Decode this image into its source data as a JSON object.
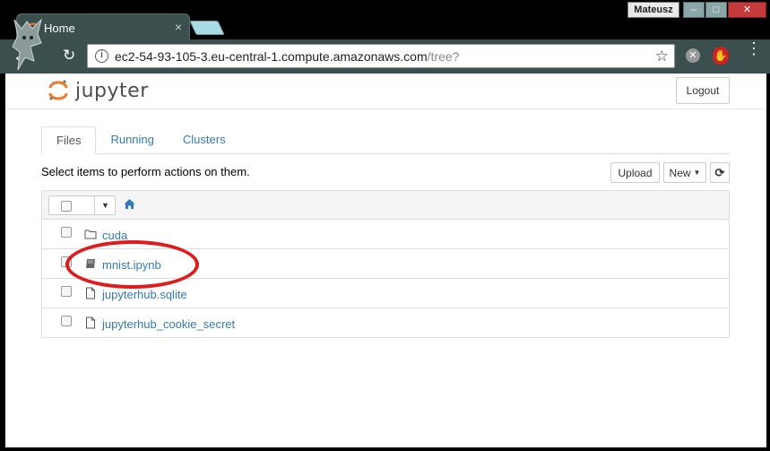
{
  "browser": {
    "tab_title": "Home",
    "tab_close": "×",
    "profile_name": "Mateusz",
    "window_buttons": [
      "–",
      "□",
      "✕"
    ],
    "url_host": "ec2-54-93-105-3.eu-central-1.compute.amazonaws.com",
    "url_path": "/tree?"
  },
  "jupyter": {
    "logo_text": "jupyter",
    "logout_label": "Logout",
    "tabs": [
      {
        "label": "Files",
        "active": true
      },
      {
        "label": "Running",
        "active": false
      },
      {
        "label": "Clusters",
        "active": false
      }
    ],
    "hint": "Select items to perform actions on them.",
    "upload_label": "Upload",
    "new_label": "New",
    "files": [
      {
        "name": "cuda",
        "icon": "folder-icon"
      },
      {
        "name": "mnist.ipynb",
        "icon": "notebook-icon"
      },
      {
        "name": "jupyterhub.sqlite",
        "icon": "file-icon"
      },
      {
        "name": "jupyterhub_cookie_secret",
        "icon": "file-icon"
      }
    ]
  },
  "colors": {
    "link": "#337ab7",
    "annotation": "#e01b1b",
    "chrome_toolbar": "#3c4f4f",
    "jupyter_orange": "#f37726"
  }
}
